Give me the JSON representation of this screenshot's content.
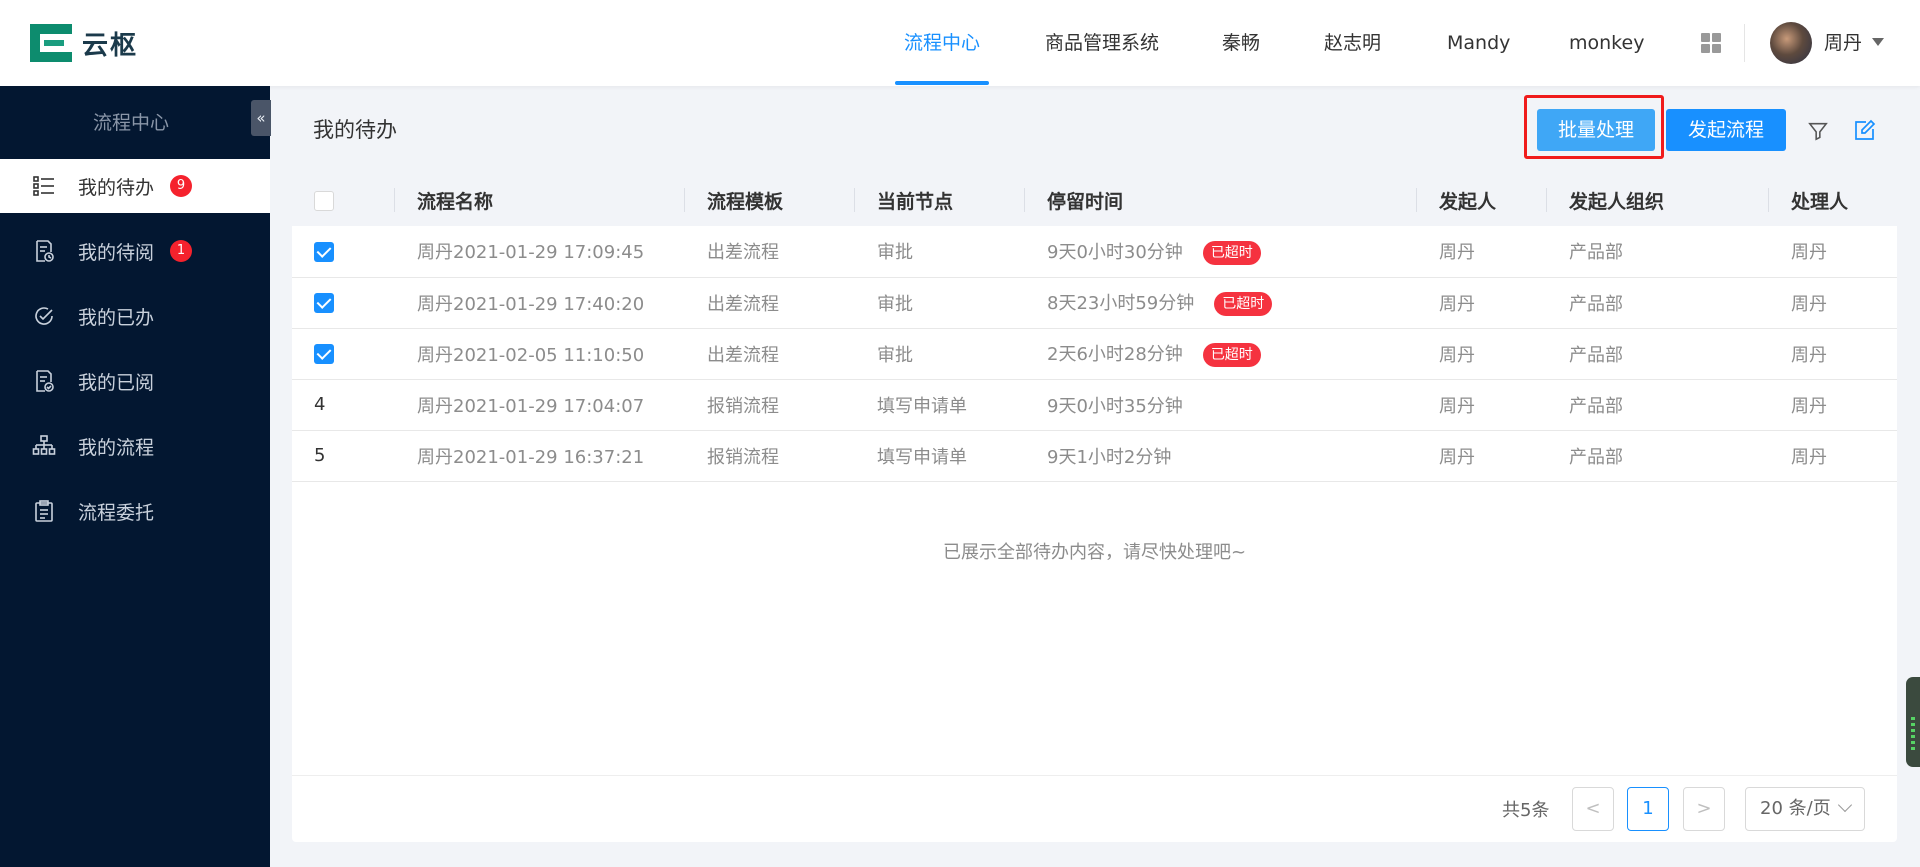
{
  "app": {
    "logo_text": "云枢"
  },
  "nav": {
    "items": [
      {
        "label": "流程中心",
        "active": true
      },
      {
        "label": "商品管理系统"
      },
      {
        "label": "秦畅"
      },
      {
        "label": "赵志明"
      },
      {
        "label": "Mandy"
      },
      {
        "label": "monkey"
      }
    ],
    "apps_icon": "grid-icon"
  },
  "user": {
    "name": "周丹"
  },
  "sidebar": {
    "title": "流程中心",
    "collapse_label": "«",
    "items": [
      {
        "label": "我的待办",
        "icon": "task-list-icon",
        "badge": "9",
        "active": true
      },
      {
        "label": "我的待阅",
        "icon": "read-pending-icon",
        "badge": "1"
      },
      {
        "label": "我的已办",
        "icon": "done-check-icon"
      },
      {
        "label": "我的已阅",
        "icon": "read-done-icon"
      },
      {
        "label": "我的流程",
        "icon": "org-flow-icon"
      },
      {
        "label": "流程委托",
        "icon": "clipboard-icon"
      }
    ]
  },
  "main": {
    "title": "我的待办",
    "batch_button": "批量处理",
    "start_button": "发起流程",
    "table": {
      "columns": [
        "",
        "流程名称",
        "流程模板",
        "当前节点",
        "停留时间",
        "发起人",
        "发起人组织",
        "处理人"
      ],
      "rows": [
        {
          "select": "checked",
          "name": "周丹2021-01-29 17:09:45",
          "template": "出差流程",
          "node": "审批",
          "stay": "9天0小时30分钟",
          "tag": "已超时",
          "initiator": "周丹",
          "org": "产品部",
          "handler": "周丹"
        },
        {
          "select": "checked",
          "name": "周丹2021-01-29 17:40:20",
          "template": "出差流程",
          "node": "审批",
          "stay": "8天23小时59分钟",
          "tag": "已超时",
          "initiator": "周丹",
          "org": "产品部",
          "handler": "周丹"
        },
        {
          "select": "checked",
          "name": "周丹2021-02-05 11:10:50",
          "template": "出差流程",
          "node": "审批",
          "stay": "2天6小时28分钟",
          "tag": "已超时",
          "initiator": "周丹",
          "org": "产品部",
          "handler": "周丹"
        },
        {
          "select": "4",
          "name": "周丹2021-01-29 17:04:07",
          "template": "报销流程",
          "node": "填写申请单",
          "stay": "9天0小时35分钟",
          "tag": "",
          "initiator": "周丹",
          "org": "产品部",
          "handler": "周丹"
        },
        {
          "select": "5",
          "name": "周丹2021-01-29 16:37:21",
          "template": "报销流程",
          "node": "填写申请单",
          "stay": "9天1小时2分钟",
          "tag": "",
          "initiator": "周丹",
          "org": "产品部",
          "handler": "周丹"
        }
      ],
      "empty_hint": "已展示全部待办内容，请尽快处理吧~"
    },
    "pagination": {
      "total": "共5条",
      "prev": "<",
      "current": "1",
      "next": ">",
      "page_size": "20 条/页"
    }
  },
  "colors": {
    "primary": "#1890ff",
    "sidebar_bg": "#031731",
    "danger": "#f5222d",
    "highlight": "#f01c1c"
  }
}
